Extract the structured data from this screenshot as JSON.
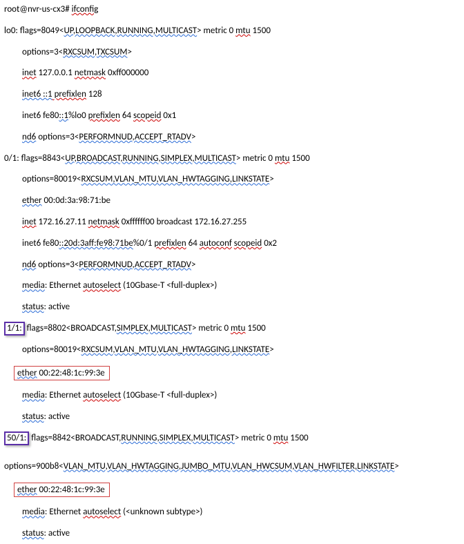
{
  "prompt": {
    "user_host": "root@nvr-us-cx3#",
    "cmd": "ifconfig"
  },
  "lo0": {
    "header_a": "lo0: flags=8049<",
    "header_b": "UP,LOOPBACK,RUNNING,MULTICAST",
    "header_c": "> metric 0 ",
    "header_d": "mtu",
    "header_e": " 1500",
    "opt_a": "options=3<",
    "opt_b": "RXCSUM,TXCSUM",
    "opt_c": ">",
    "inet_a": "inet",
    "inet_b": " 127.0.0.1 ",
    "inet_c": "netmask",
    "inet_d": " 0xff000000",
    "inet6a_a": "inet6 ::1",
    "inet6a_b": " prefixlen",
    "inet6a_c": " 128",
    "inet6b_a": "inet6 fe80",
    "inet6b_b": "::1",
    "inet6b_c": "%lo0 ",
    "inet6b_d": "prefixlen",
    "inet6b_e": " 64 ",
    "inet6b_f": "scopeid",
    "inet6b_g": " 0x1",
    "nd6_a": "nd6",
    "nd6_b": " options=3<",
    "nd6_c": "PERFORMNUD,ACCEPT_RTADV",
    "nd6_d": ">"
  },
  "if01": {
    "header_a": "0/1: flags=8843<",
    "header_b": "UP,BROADCAST,RUNNING,SIMPLEX,MULTICAST",
    "header_c": "> metric 0 ",
    "header_d": "mtu",
    "header_e": " 1500",
    "opt_a": "options=80019<",
    "opt_b": "RXCSUM,VLAN_MTU,VLAN_HWTAGGING,LINKSTATE",
    "opt_c": ">",
    "eth_a": "ether",
    "eth_b": " 00:0d:3a:98:71:be",
    "inet_a": "inet",
    "inet_b": " 172.16.27.11 ",
    "inet_c": "netmask",
    "inet_d": " 0xffffff00 broadcast 172.16.27.255",
    "inet6_a": "inet6 fe80",
    "inet6_b": "::20d:3aff:fe98:71be",
    "inet6_c": "%0/1 ",
    "inet6_d": "prefixlen",
    "inet6_e": " 64 ",
    "inet6_f": "autoconf",
    "inet6_g": " ",
    "inet6_h": "scopeid",
    "inet6_i": " 0x2",
    "nd6_a": "nd6",
    "nd6_b": " options=3<",
    "nd6_c": "PERFORMNUD,ACCEPT_RTADV",
    "nd6_d": ">",
    "media_a": "media",
    "media_b": ": Ethernet ",
    "media_c": "autoselect",
    "media_d": " (10Gbase-T <full-duplex>)",
    "status_a": "status",
    "status_b": ": active"
  },
  "if11": {
    "tag": "1/1:",
    "header_a": " flags=8802<",
    "header_b": "BROADCAST,",
    "header_c": "SIMPLEX,MULTICAST",
    "header_d": "> metric 0 ",
    "header_e": "mtu",
    "header_f": " 1500",
    "opt_a": "options=80019<",
    "opt_b": "RXCSUM,VLAN_MTU,VLAN_HWTAGGING,LINKSTATE",
    "opt_c": ">",
    "eth_a": "ether",
    "eth_b": " 00:22:48:1c:99:3e",
    "media_a": "media",
    "media_b": ": Ethernet ",
    "media_c": "autoselect",
    "media_d": " (10Gbase-T <full-duplex>)",
    "status_a": "status",
    "status_b": ": active"
  },
  "if501": {
    "tag": "50/1:",
    "header_a": " flags=8842<BROADCAST,",
    "header_b": "RUNNING,SIMPLEX,MULTICAST",
    "header_c": "> metric 0 ",
    "header_d": "mtu",
    "header_e": " 1500",
    "opt_a": "options=900b8<",
    "opt_b": "VLAN_MTU,VLAN_HWTAGGING,JUMBO_MTU,VLAN_HWCSUM,VLAN_HWFILTER,LINKSTATE",
    "opt_c": ">",
    "eth_a": "ether",
    "eth_b": " 00:22:48:1c:99:3e",
    "media_a": "media",
    "media_b": ": Ethernet ",
    "media_c": "autoselect",
    "media_d": " (<unknown subtype>)",
    "status_a": "status",
    "status_b": ": active"
  }
}
